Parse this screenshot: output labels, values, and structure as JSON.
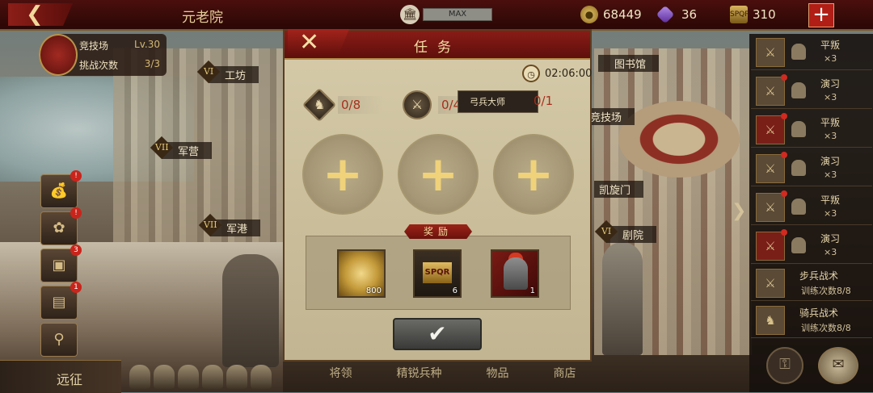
{
  "topbar": {
    "back_icon": "back-arrow-icon",
    "title": "元老院",
    "max_label": "MAX",
    "resources": {
      "coins": "68449",
      "gems": "36",
      "spqr": "310"
    },
    "add_icon": "plus-icon"
  },
  "arena": {
    "name": "竞技场",
    "level": "Lv.30",
    "challenge_label": "挑战次数",
    "challenge_count": "3/3"
  },
  "map_labels": [
    {
      "numeral": "VI",
      "text": "工坊"
    },
    {
      "numeral": "VII",
      "text": "军营"
    },
    {
      "numeral": "VII",
      "text": "军港"
    },
    {
      "numeral": "",
      "text": "图书馆"
    },
    {
      "numeral": "",
      "text": "竞技场"
    },
    {
      "numeral": "",
      "text": "凯旋门"
    },
    {
      "numeral": "VI",
      "text": "剧院"
    }
  ],
  "side_buttons": [
    {
      "icon": "treasure-bag-icon",
      "badge": "!"
    },
    {
      "icon": "laurel-crown-icon",
      "badge": "!"
    },
    {
      "icon": "film-strip-icon",
      "badge": "3"
    },
    {
      "icon": "chest-icon",
      "badge": "1"
    },
    {
      "icon": "trophy-icon",
      "badge": ""
    }
  ],
  "expedition_label": "远征",
  "bottom_tabs": [
    "将领",
    "精锐兵种",
    "物品",
    "商店"
  ],
  "events": [
    {
      "name": "平叛",
      "times": "×3",
      "red": false
    },
    {
      "name": "演习",
      "times": "×3",
      "red": false
    },
    {
      "name": "平叛",
      "times": "×3",
      "red": true
    },
    {
      "name": "演习",
      "times": "×3",
      "red": false
    },
    {
      "name": "平叛",
      "times": "×3",
      "red": false
    },
    {
      "name": "演习",
      "times": "×3",
      "red": true
    }
  ],
  "trainings": [
    {
      "name": "步兵战术",
      "count": "训练次数8/8"
    },
    {
      "name": "骑兵战术",
      "count": "训练次数8/8"
    }
  ],
  "modal": {
    "title": "任务",
    "timer": "02:06:00",
    "requirements": [
      {
        "icon": "horse-icon",
        "progress": "0/8"
      },
      {
        "icon": "swordsmen-icon",
        "progress": "0/4"
      }
    ],
    "archer": {
      "label": "弓兵大师",
      "progress": "0/1"
    },
    "slot_plus": "+",
    "reward_label": "奖励",
    "rewards": [
      {
        "icon": "gold-coin-icon",
        "qty": "800"
      },
      {
        "icon": "spqr-eagle-icon",
        "badge": "SPQR",
        "qty": "6"
      },
      {
        "icon": "roman-helmet-icon",
        "qty": "1"
      }
    ],
    "confirm_icon": "checkmark-icon"
  }
}
